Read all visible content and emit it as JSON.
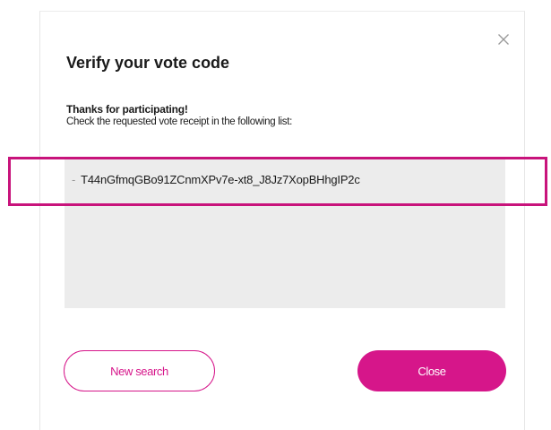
{
  "dialog": {
    "title": "Verify your vote code",
    "subtitle": "Thanks for participating!",
    "instructions": "Check the requested vote receipt in the following list:",
    "receipts": [
      {
        "bullet": "-",
        "code": "T44nGfmqGBo91ZCnmXPv7e-xt8_J8Jz7XopBHhgIP2c"
      }
    ],
    "buttons": {
      "new_search": "New search",
      "close": "Close"
    },
    "icons": {
      "close": "close-icon"
    }
  },
  "colors": {
    "accent": "#d6168a",
    "highlight": "#c8137b",
    "list_background": "#ececec",
    "text": "#1a1a1a"
  }
}
